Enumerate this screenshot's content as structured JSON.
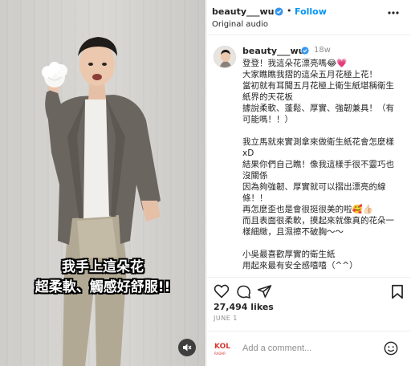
{
  "post": {
    "username": "beauty___wu",
    "follow_label": "Follow",
    "separator": "•",
    "audio_label": "Original audio",
    "time_ago": "18w",
    "caption_lines": [
      "登登！我這朵花漂亮嗎😂💗",
      "大家瞧瞧我摺的這朵五月花極上花！",
      "當初就有耳聞五月花極上衛生紙堪稱衛生",
      "紙界的天花板",
      "據說柔軟、蓬鬆、厚實、強韌兼具！（有",
      "可能嗎！！）",
      "",
      "我立馬就來實測拿來做衛生紙花會怎麼樣",
      "xD",
      "結果你們自己瞧！像我這樣手很不靈巧也",
      "沒關係",
      "因為夠強韌、厚實就可以摺出漂亮的線",
      "條！！",
      "再怎麼歪也是會很挺很美的啦🥰👍🏻",
      "而且表面很柔軟，摸起來就像真的花朵一",
      "樣細緻，且濕擦不破胸～～",
      "",
      "小吳最喜歡厚實的衛生紙",
      "用起來最有安全感嘻嘻（^^）"
    ],
    "likes": "27,494 likes",
    "date": "JUNE 1",
    "comment_placeholder": "Add a comment...",
    "kol_logo": "KOL",
    "kol_logo_sub": "RADAR"
  },
  "video": {
    "caption_line1": "我手上這朵花",
    "caption_line2": "超柔軟、觸感好舒服!!"
  },
  "icons": {
    "verified": "verified-badge-icon",
    "more": "more-options-icon",
    "like": "heart-icon",
    "comment": "comment-icon",
    "share": "share-icon",
    "save": "bookmark-icon",
    "emoji": "emoji-icon",
    "mute": "muted-speaker-icon"
  },
  "colors": {
    "accent": "#0095f6",
    "verified": "#3897f0",
    "kol": "#d43a2f"
  }
}
